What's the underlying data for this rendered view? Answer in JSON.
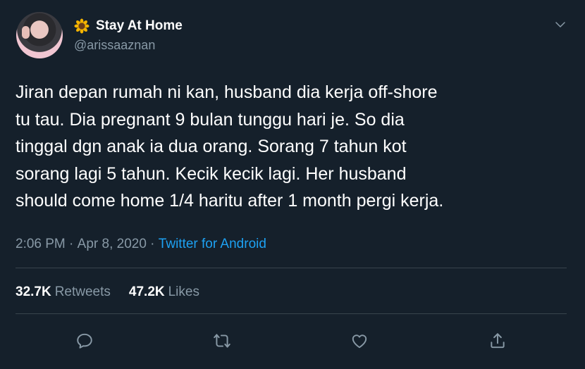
{
  "user": {
    "display_name": "Stay At Home",
    "handle": "@arissaaznan",
    "name_emoji_icon": "sunflower-icon"
  },
  "tweet": {
    "text": "Jiran depan rumah ni kan, husband dia kerja off-shore\ntu tau. Dia pregnant 9 bulan tunggu hari je. So dia\ntinggal dgn anak ia dua orang. Sorang 7 tahun kot\nsorang lagi 5 tahun. Kecik kecik lagi. Her husband\nshould come home 1/4 haritu after 1 month pergi kerja.",
    "time": "2:06 PM",
    "separator1": " · ",
    "date": "Apr 8, 2020",
    "separator2": " · ",
    "source": "Twitter for Android"
  },
  "stats": {
    "retweets_count": "32.7K",
    "retweets_label": "Retweets",
    "likes_count": "47.2K",
    "likes_label": "Likes"
  },
  "actions": [
    {
      "name": "reply",
      "icon": "reply-icon"
    },
    {
      "name": "retweet",
      "icon": "retweet-icon"
    },
    {
      "name": "like",
      "icon": "heart-icon"
    },
    {
      "name": "share",
      "icon": "share-icon"
    }
  ],
  "colors": {
    "background": "#15202b",
    "primary_text": "#ffffff",
    "secondary_text": "#8899a6",
    "accent": "#1da1f2",
    "divider": "#38444d"
  }
}
